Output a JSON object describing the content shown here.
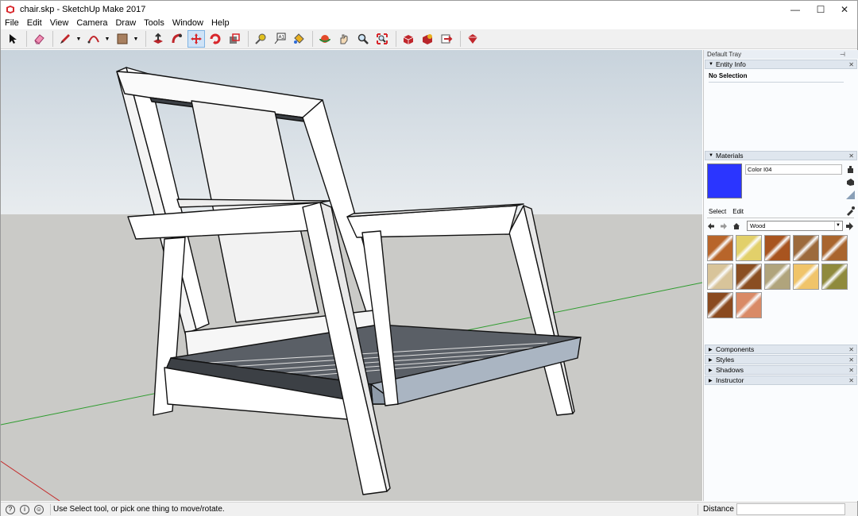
{
  "window": {
    "title": "chair.skp - SketchUp Make 2017",
    "minimize": "—",
    "maximize": "☐",
    "close": "✕"
  },
  "menu": [
    "File",
    "Edit",
    "View",
    "Camera",
    "Draw",
    "Tools",
    "Window",
    "Help"
  ],
  "toolbar": {
    "tools": [
      "select",
      "eraser",
      "line",
      "arc",
      "shapes",
      "push-pull",
      "follow-me",
      "move",
      "rotate",
      "scale",
      "tape-measure",
      "text",
      "paint-bucket",
      "orbit",
      "pan",
      "zoom",
      "zoom-extents",
      "3d-warehouse",
      "extension-warehouse",
      "layout",
      "extension-manager"
    ],
    "active_tool": "move"
  },
  "tray": {
    "title": "Default Tray",
    "pin": "⊣",
    "entity_info": {
      "header": "Entity Info",
      "selection": "No Selection"
    },
    "materials": {
      "header": "Materials",
      "current_color_name": "Color I04",
      "current_color": "#2b35ff",
      "tabs": [
        "Select",
        "Edit"
      ],
      "library": "Wood",
      "swatches": [
        "#b8652a",
        "#e2d06a",
        "#a8541f",
        "#9c6a3c",
        "#a9652e",
        "#d8c49a",
        "#8a4e22",
        "#b0a47c",
        "#f0c46a",
        "#8f8a3c",
        "#8a4a1f",
        "#d98a66"
      ]
    },
    "collapsed_panels": [
      "Components",
      "Styles",
      "Shadows",
      "Instructor"
    ]
  },
  "status": {
    "message": "Use Select tool, or pick one thing to move/rotate.",
    "distance_label": "Distance",
    "distance_value": ""
  },
  "scene": {
    "sky_color": "#dfe6ec",
    "ground_color": "#cacac7",
    "green_axis": "#2e9c2e",
    "red_axis": "#c42a2a",
    "wood_face": "#ffffff",
    "slat_color": "#3c4045"
  }
}
